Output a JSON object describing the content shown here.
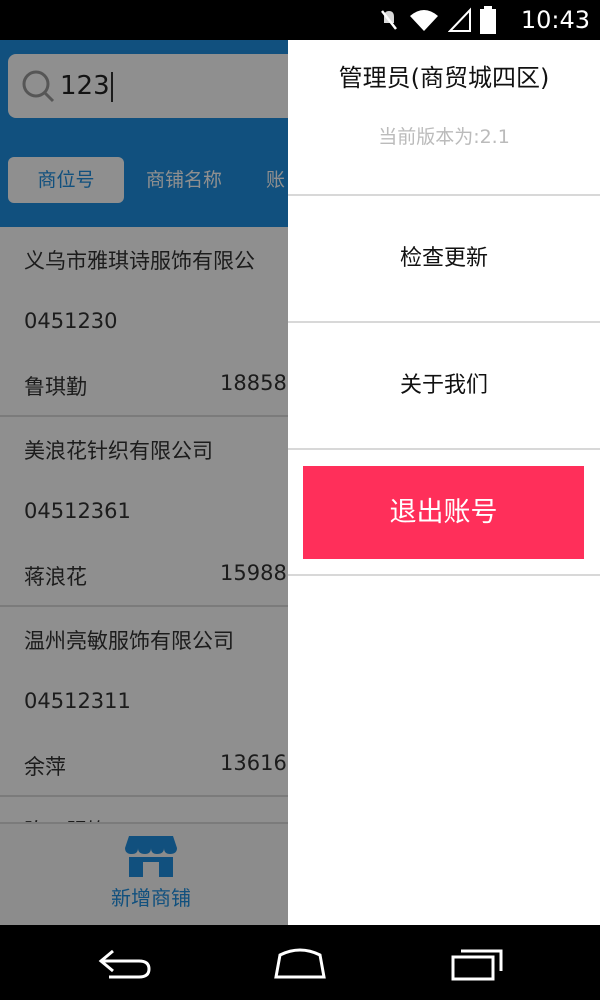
{
  "status_bar": {
    "time": "10:43",
    "icons": [
      "muted-icon",
      "wifi-icon",
      "signal-icon",
      "battery-icon"
    ]
  },
  "search": {
    "value": "123",
    "icon": "search-icon"
  },
  "tabs": [
    {
      "label": "商位号",
      "active": true
    },
    {
      "label": "商铺名称",
      "active": false
    },
    {
      "label": "账",
      "active": false
    }
  ],
  "list": [
    {
      "name": "义乌市雅琪诗服饰有限公",
      "code": "0451230",
      "contact": "鲁琪勤",
      "phone": "18858"
    },
    {
      "name": "美浪花针织有限公司",
      "code": "04512361",
      "contact": "蒋浪花",
      "phone": "15988"
    },
    {
      "name": "温州亮敏服饰有限公司",
      "code": "04512311",
      "contact": "余萍",
      "phone": "13616"
    },
    {
      "name": "陈工服饰",
      "code": "",
      "contact": "",
      "phone": ""
    }
  ],
  "bottom_bar": {
    "add_shop_label": "新增商铺",
    "add_shop_icon": "storefront-icon"
  },
  "drawer": {
    "user_title": "管理员(商贸城四区)",
    "version": "当前版本为:2.1",
    "check_update": "检查更新",
    "about_us": "关于我们",
    "logout": "退出账号"
  },
  "nav_bar": {
    "icons": [
      "back-icon",
      "home-icon",
      "recent-apps-icon"
    ]
  },
  "colors": {
    "primary": "#1f8fe0",
    "logout": "#ff2f5a"
  }
}
